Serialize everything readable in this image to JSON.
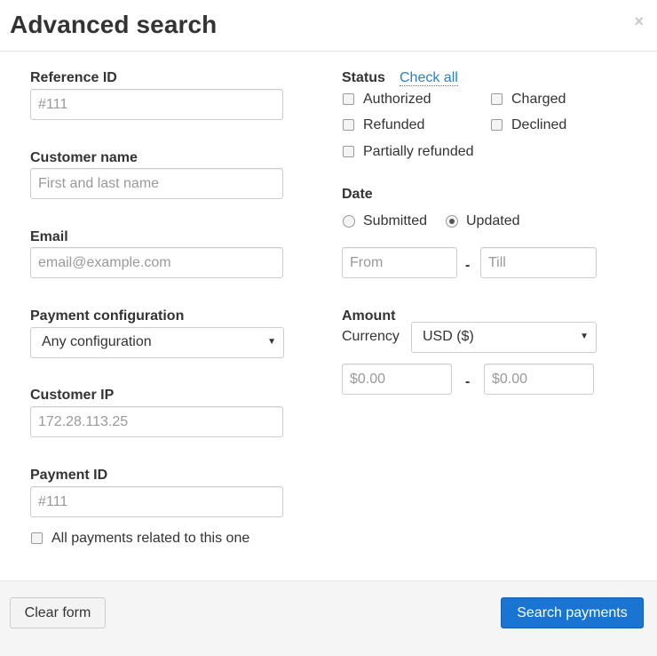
{
  "dialog": {
    "title": "Advanced search",
    "close_glyph": "×"
  },
  "left": {
    "reference_id": {
      "label": "Reference ID",
      "placeholder": "#111",
      "value": ""
    },
    "customer_name": {
      "label": "Customer name",
      "placeholder": "First and last name",
      "value": ""
    },
    "email": {
      "label": "Email",
      "placeholder": "email@example.com",
      "value": ""
    },
    "payment_configuration": {
      "label": "Payment configuration",
      "selected": "Any configuration"
    },
    "customer_ip": {
      "label": "Customer IP",
      "placeholder": "172.28.113.25",
      "value": ""
    },
    "payment_id": {
      "label": "Payment ID",
      "placeholder": "#111",
      "value": ""
    },
    "related_checkbox": {
      "label": "All payments related to this one",
      "checked": false
    }
  },
  "right": {
    "status": {
      "label": "Status",
      "check_all": "Check all",
      "options": [
        {
          "label": "Authorized",
          "checked": false
        },
        {
          "label": "Charged",
          "checked": false
        },
        {
          "label": "Refunded",
          "checked": false
        },
        {
          "label": "Declined",
          "checked": false
        },
        {
          "label": "Partially refunded",
          "checked": false
        }
      ]
    },
    "date": {
      "label": "Date",
      "options": [
        {
          "label": "Submitted",
          "selected": false
        },
        {
          "label": "Updated",
          "selected": true
        }
      ],
      "from_placeholder": "From",
      "till_placeholder": "Till",
      "separator": "-"
    },
    "amount": {
      "label": "Amount",
      "currency_label": "Currency",
      "currency_selected": "USD ($)",
      "min_placeholder": "$0.00",
      "max_placeholder": "$0.00",
      "separator": "-"
    }
  },
  "footer": {
    "clear_label": "Clear form",
    "search_label": "Search payments"
  },
  "colors": {
    "primary_button": "#1a74d2",
    "link": "#2a7ec4",
    "footer_bg": "#f5f5f5"
  },
  "icons": {
    "close": "close-icon",
    "dropdown": "chevron-down-icon"
  }
}
